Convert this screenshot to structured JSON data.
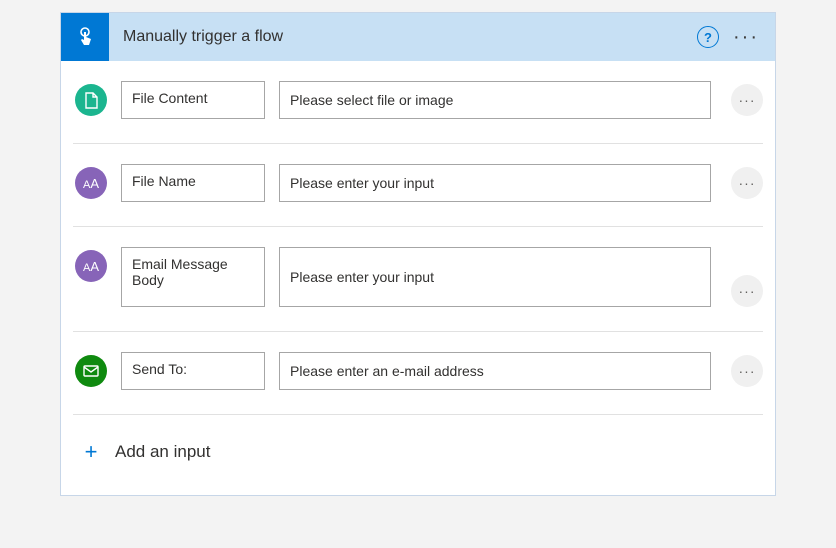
{
  "header": {
    "title": "Manually trigger a flow"
  },
  "inputs": [
    {
      "label": "File Content",
      "placeholder": "Please select file or image"
    },
    {
      "label": "File Name",
      "placeholder": "Please enter your input"
    },
    {
      "label": "Email Message Body",
      "placeholder": "Please enter your input"
    },
    {
      "label": "Send To:",
      "placeholder": "Please enter an e-mail address"
    }
  ],
  "addInput": "Add an input"
}
